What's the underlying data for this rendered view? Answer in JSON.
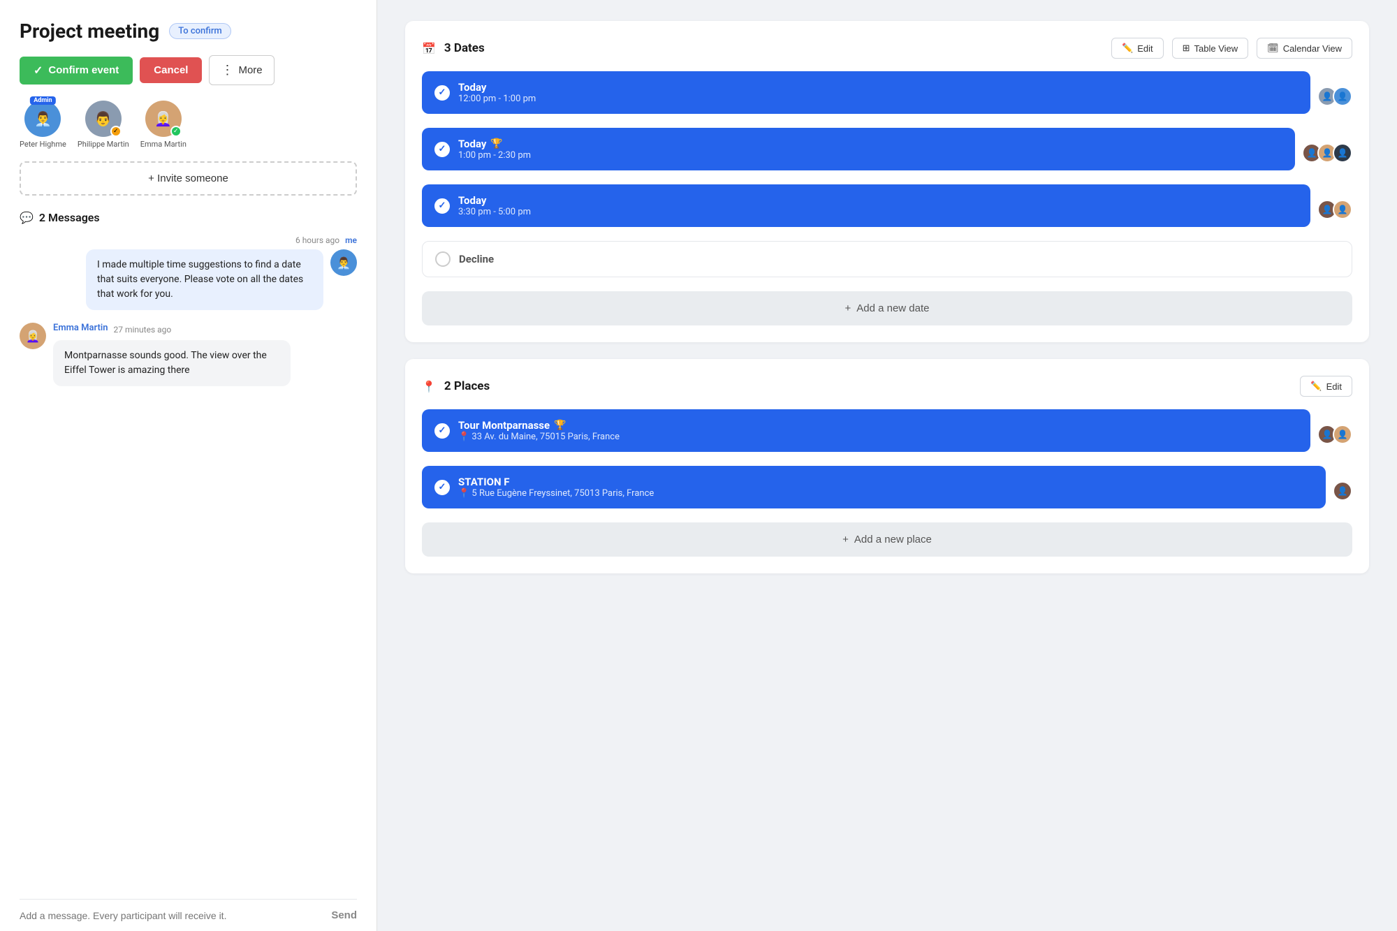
{
  "page": {
    "title": "Project meeting",
    "status_badge": "To confirm"
  },
  "actions": {
    "confirm_label": "Confirm event",
    "cancel_label": "Cancel",
    "more_label": "More"
  },
  "participants": [
    {
      "name": "Peter Highme",
      "role": "admin",
      "avatar_emoji": "👨‍💼",
      "badge": "admin"
    },
    {
      "name": "Philippe Martin",
      "role": "user",
      "avatar_emoji": "👨",
      "badge": "verified"
    },
    {
      "name": "Emma Martin",
      "role": "user",
      "avatar_emoji": "👩‍🦳",
      "badge": "green"
    }
  ],
  "invite_btn": "+ Invite someone",
  "messages_section": {
    "header": "2 Messages",
    "messages": [
      {
        "id": 1,
        "author": "me",
        "time": "6 hours ago",
        "tag": "me",
        "text": "I made multiple time suggestions to find a date that suits everyone. Please vote on all the dates that work for you.",
        "avatar_emoji": "👨‍💼"
      },
      {
        "id": 2,
        "author": "Emma Martin",
        "time": "27 minutes ago",
        "tag": "",
        "text": "Montparnasse sounds good. The view over the Eiffel Tower is amazing there",
        "avatar_emoji": "👩‍🦳"
      }
    ],
    "input_placeholder": "Add a message. Every participant will receive it.",
    "send_label": "Send"
  },
  "dates_section": {
    "title": "3 Dates",
    "edit_label": "Edit",
    "table_view_label": "Table View",
    "calendar_view_label": "Calendar View",
    "dates": [
      {
        "day": "Today",
        "time": "12:00 pm - 1:00 pm",
        "checked": true,
        "trophy": false,
        "avatars": [
          "av-gray",
          "av-blue"
        ]
      },
      {
        "day": "Today",
        "time": "1:00 pm - 2:30 pm",
        "checked": true,
        "trophy": true,
        "avatars": [
          "av-brown",
          "av-blonde",
          "av-dark"
        ]
      },
      {
        "day": "Today",
        "time": "3:30 pm - 5:00 pm",
        "checked": true,
        "trophy": false,
        "avatars": [
          "av-brown",
          "av-blonde"
        ]
      }
    ],
    "decline_label": "Decline",
    "add_date_label": "Add a new date"
  },
  "places_section": {
    "title": "2 Places",
    "edit_label": "Edit",
    "places": [
      {
        "name": "Tour Montparnasse",
        "address": "33 Av. du Maine, 75015 Paris, France",
        "trophy": true,
        "checked": true,
        "avatars": [
          "av-brown",
          "av-blonde"
        ]
      },
      {
        "name": "STATION F",
        "address": "5 Rue Eugène Freyssinet, 75013 Paris, France",
        "trophy": false,
        "checked": true,
        "avatars": [
          "av-brown"
        ]
      }
    ],
    "add_place_label": "Add a new place"
  },
  "icons": {
    "calendar": "📅",
    "pin": "📍",
    "chat": "💬",
    "pencil": "✏️",
    "table": "⊞",
    "cal_small": "🗓",
    "plus": "+",
    "check": "✓",
    "dots": "⋮",
    "trophy": "🏆"
  }
}
